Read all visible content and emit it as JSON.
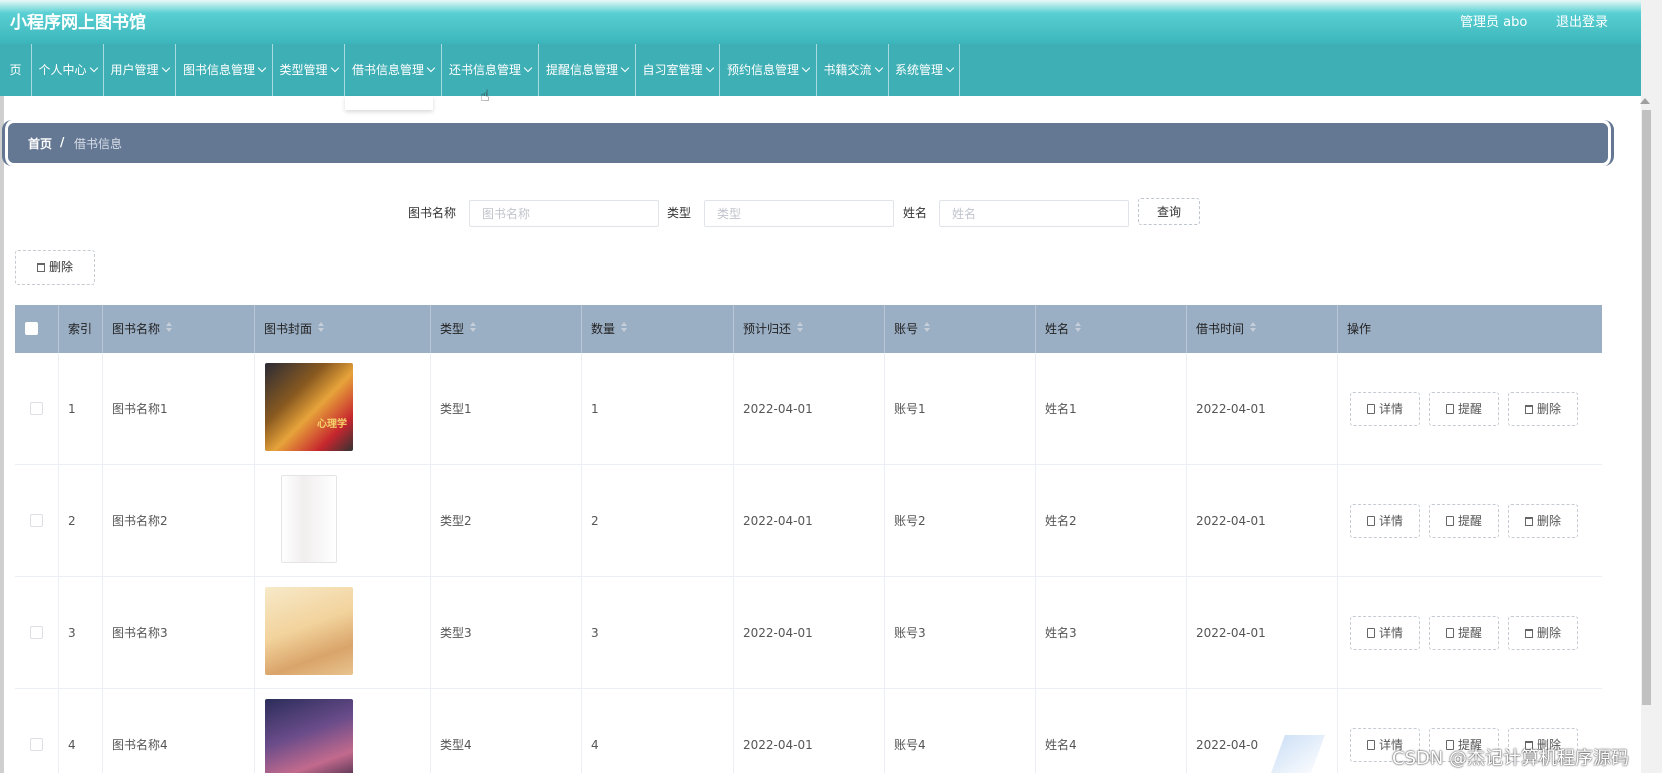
{
  "header": {
    "title": "小程序网上图书馆",
    "user": "管理员 abo",
    "logout": "退出登录"
  },
  "nav": [
    {
      "label": "页"
    },
    {
      "label": "个人中心"
    },
    {
      "label": "用户管理"
    },
    {
      "label": "图书信息管理"
    },
    {
      "label": "类型管理"
    },
    {
      "label": "借书信息管理"
    },
    {
      "label": "还书信息管理"
    },
    {
      "label": "提醒信息管理"
    },
    {
      "label": "自习室管理"
    },
    {
      "label": "预约信息管理"
    },
    {
      "label": "书籍交流"
    },
    {
      "label": "系统管理"
    }
  ],
  "breadcrumb": {
    "home": "首页",
    "sep": "/",
    "current": "借书信息"
  },
  "search": {
    "book_name_label": "图书名称",
    "book_name_placeholder": "图书名称",
    "type_label": "类型",
    "type_placeholder": "类型",
    "name_label": "姓名",
    "name_placeholder": "姓名",
    "query": "查询"
  },
  "toolbar": {
    "delete": "删除"
  },
  "table": {
    "headers": [
      "索引",
      "图书名称",
      "图书封面",
      "类型",
      "数量",
      "预计归还",
      "账号",
      "姓名",
      "借书时间",
      "操作"
    ],
    "rows": [
      {
        "idx": "1",
        "book": "图书名称1",
        "type": "类型1",
        "qty": "1",
        "due": "2022-04-01",
        "account": "账号1",
        "name": "姓名1",
        "borrow": "2022-04-01",
        "cover_text": "心理学"
      },
      {
        "idx": "2",
        "book": "图书名称2",
        "type": "类型2",
        "qty": "2",
        "due": "2022-04-01",
        "account": "账号2",
        "name": "姓名2",
        "borrow": "2022-04-01",
        "cover_text": ""
      },
      {
        "idx": "3",
        "book": "图书名称3",
        "type": "类型3",
        "qty": "3",
        "due": "2022-04-01",
        "account": "账号3",
        "name": "姓名3",
        "borrow": "2022-04-01",
        "cover_text": ""
      },
      {
        "idx": "4",
        "book": "图书名称4",
        "type": "类型4",
        "qty": "4",
        "due": "2022-04-01",
        "account": "账号4",
        "name": "姓名4",
        "borrow": "2022-04-0",
        "cover_text": ""
      }
    ],
    "ops": {
      "detail": "详情",
      "remind": "提醒",
      "delete": "删除"
    }
  },
  "watermark": "CSDN @杰记计算机程序源码"
}
